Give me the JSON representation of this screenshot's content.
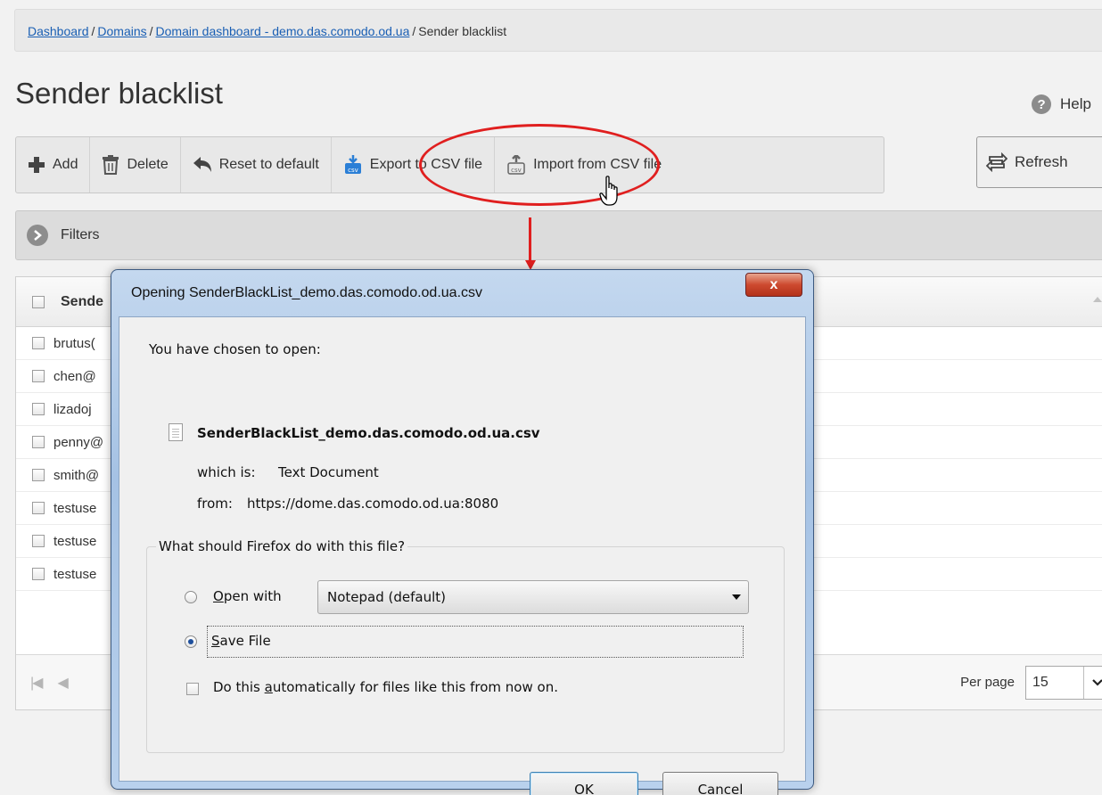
{
  "breadcrumb": {
    "items": [
      "Dashboard",
      "Domains",
      "Domain dashboard - demo.das.comodo.od.ua"
    ],
    "current": "Sender blacklist",
    "separator": "/"
  },
  "page": {
    "title": "Sender blacklist",
    "help_label": "Help",
    "help_glyph": "?"
  },
  "toolbar": {
    "add_label": "Add",
    "delete_label": "Delete",
    "reset_label": "Reset to default",
    "export_label": "Export to CSV file",
    "import_label": "Import from CSV file",
    "refresh_label": "Refresh"
  },
  "filters": {
    "label": "Filters"
  },
  "grid": {
    "header_label": "Sende",
    "rows": [
      "brutus(",
      "chen@",
      "lizadoj",
      "penny@",
      "smith@",
      "testuse",
      "testuse",
      "testuse"
    ],
    "per_page_label": "Per page",
    "per_page_value": "15",
    "pager_first_glyph": "|◀",
    "pager_prev_glyph": "◀"
  },
  "dialog": {
    "title": "Opening SenderBlackList_demo.das.comodo.od.ua.csv",
    "close_glyph": "x",
    "chosen_label": "You have chosen to open:",
    "file_name": "SenderBlackList_demo.das.comodo.od.ua.csv",
    "which_is_label": "which is:",
    "which_is_value": "Text Document",
    "from_label": "from:",
    "from_value": "https://dome.das.comodo.od.ua:8080",
    "question": "What should Firefox do with this file?",
    "open_with_prefix": "O",
    "open_with_rest": "pen with",
    "open_with_app": "Notepad (default)",
    "save_prefix": "S",
    "save_rest": "ave File",
    "auto_before": "Do this ",
    "auto_accel": "a",
    "auto_after": "utomatically for files like this from now on.",
    "ok_label": "OK",
    "cancel_label": "Cancel",
    "selected_option": "Save File",
    "auto_checked": false
  },
  "colors": {
    "annotation": "#e01f1f",
    "link": "#1a5fb4",
    "dialog_frame": "#a5c2e4"
  }
}
